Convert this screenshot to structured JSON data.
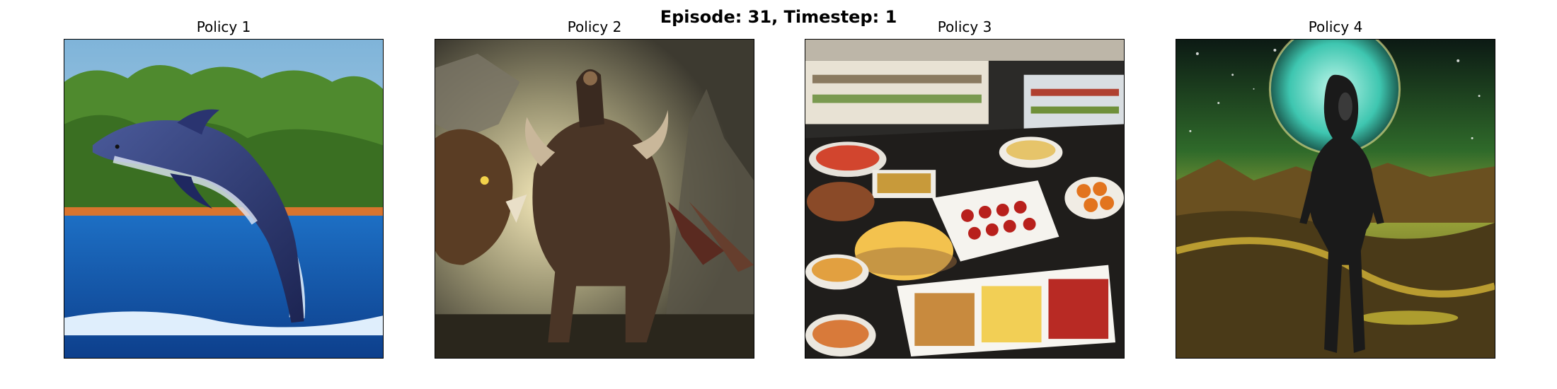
{
  "figure": {
    "suptitle": "Episode: 31, Timestep: 1",
    "panels": [
      {
        "title": "Policy 1",
        "image": "dolphin-leaping-from-water"
      },
      {
        "title": "Policy 2",
        "image": "fantasy-warrior-riding-beast"
      },
      {
        "title": "Policy 3",
        "image": "buffet-food-spread"
      },
      {
        "title": "Policy 4",
        "image": "alien-figure-under-glowing-planet"
      }
    ]
  }
}
